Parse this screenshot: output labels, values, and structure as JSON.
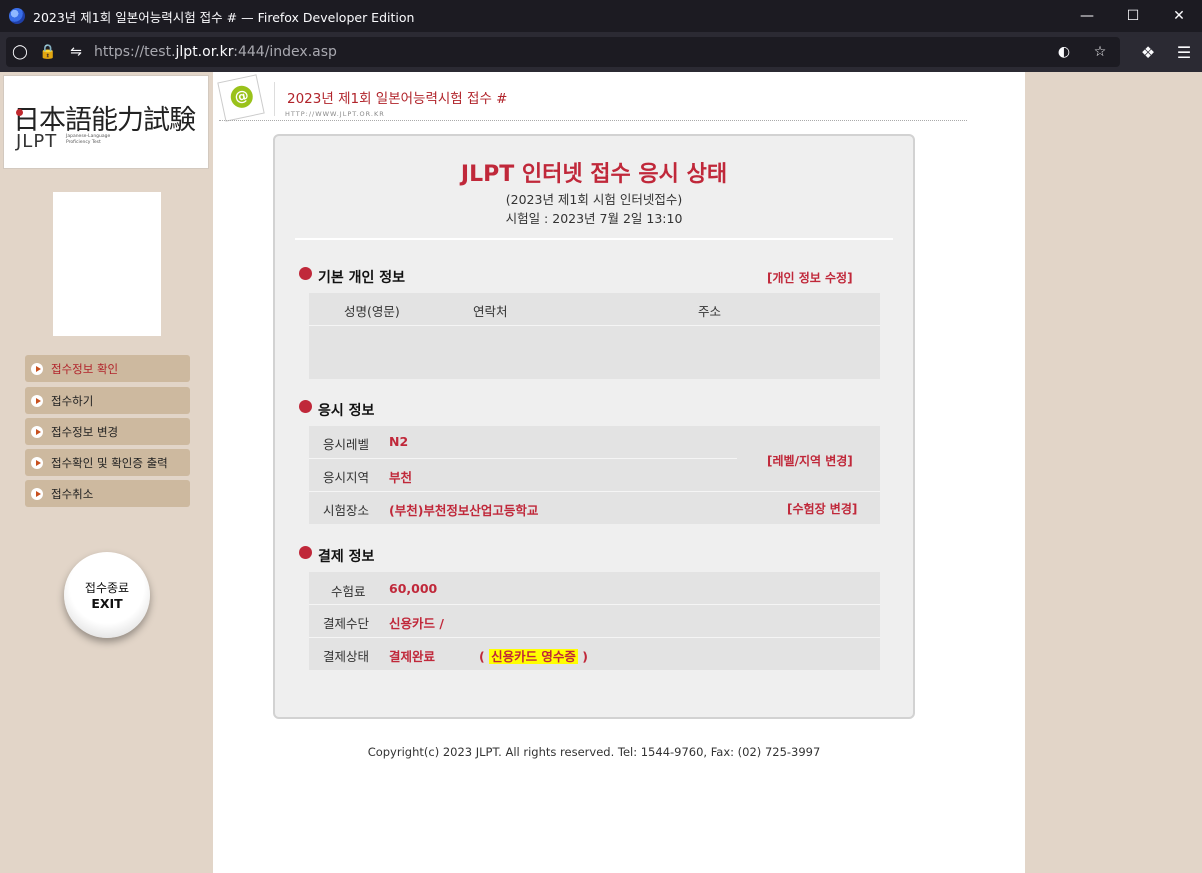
{
  "browser": {
    "window_title": "2023년 제1회 일본어능력시험 접수 # — Firefox Developer Edition",
    "url_prefix": "https://test.",
    "url_domain": "jlpt.or.kr",
    "url_suffix": ":444/index.asp"
  },
  "logo": {
    "kanji": "日本語能力試験",
    "jlpt": "JLPT",
    "subtitle": "Japanese-Language Proficiency Test"
  },
  "sidebar": {
    "menu": [
      {
        "label": "접수정보  확인"
      },
      {
        "label": "접수하기"
      },
      {
        "label": "접수정보 변경"
      },
      {
        "label": "접수확인 및 확인증 출력"
      },
      {
        "label": "접수취소"
      }
    ],
    "exit_ko": "접수종료",
    "exit_en": "EXIT"
  },
  "header": {
    "title": "2023년 제1회 일본어능력시험 접수 #",
    "url": "HTTP://WWW.JLPT.OR.KR"
  },
  "card": {
    "title": "JLPT 인터넷 접수 응시 상태",
    "subtitle": "(2023년 제1회 시험 인터넷접수)",
    "exam_date": "시험일 : 2023년 7월 2일 13:10"
  },
  "personal": {
    "section_title": "기본 개인 정보",
    "edit_link": "[개인 정보 수정]",
    "columns": [
      "성명(영문)",
      "연락처",
      "주소"
    ]
  },
  "exam": {
    "section_title": "응시 정보",
    "level_label": "응시레벨",
    "level_value": "N2",
    "region_label": "응시지역",
    "region_value": "부천",
    "change_level_link": "[레벨/지역 변경]",
    "venue_label": "시험장소",
    "venue_value": "(부천)부천정보산업고등학교",
    "change_venue_link": "[수험장 변경]"
  },
  "payment": {
    "section_title": "결제 정보",
    "fee_label": "수험료",
    "fee_value": "60,000",
    "method_label": "결제수단",
    "method_value": "신용카드 /",
    "status_label": "결제상태",
    "status_value": "결제완료",
    "receipt_open": "(",
    "receipt_link": "신용카드 영수증",
    "receipt_close": ")"
  },
  "footer": "Copyright(c) 2023 JLPT. All rights reserved. Tel: 1544-9760, Fax: (02) 725-3997"
}
